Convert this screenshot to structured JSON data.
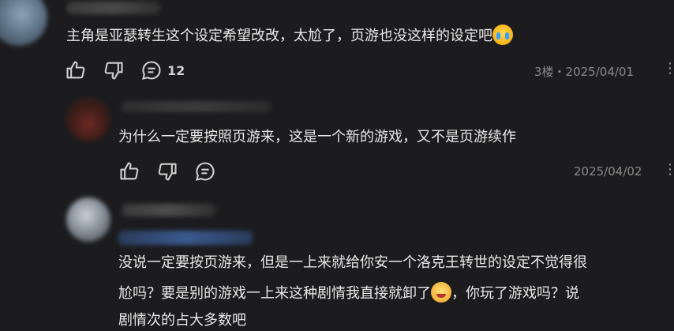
{
  "comment1": {
    "text": "主角是亚瑟转生这个设定希望改改，太尬了，页游也没这样的设定吧",
    "reply_count": "12",
    "meta": "3楼・2025/04/01",
    "emoji": "crying-face"
  },
  "reply1": {
    "text": "为什么一定要按照页游来，这是一个新的游戏，又不是页游续作",
    "date": "2025/04/02"
  },
  "reply2": {
    "line1": "没说一定要按页游来，但是一上来就给你安一个洛克王转世的设定不觉得很",
    "line2a": "尬吗？要是别的游戏一上来这种剧情我直接就卸了",
    "line2b": "，你玩了游戏吗？说",
    "line3": "剧情次的占大多数吧",
    "emoji": "grinning-face"
  },
  "colors": {
    "background": "#1c1c1e",
    "text": "#e8e8e8",
    "meta": "#8a8a8a"
  }
}
